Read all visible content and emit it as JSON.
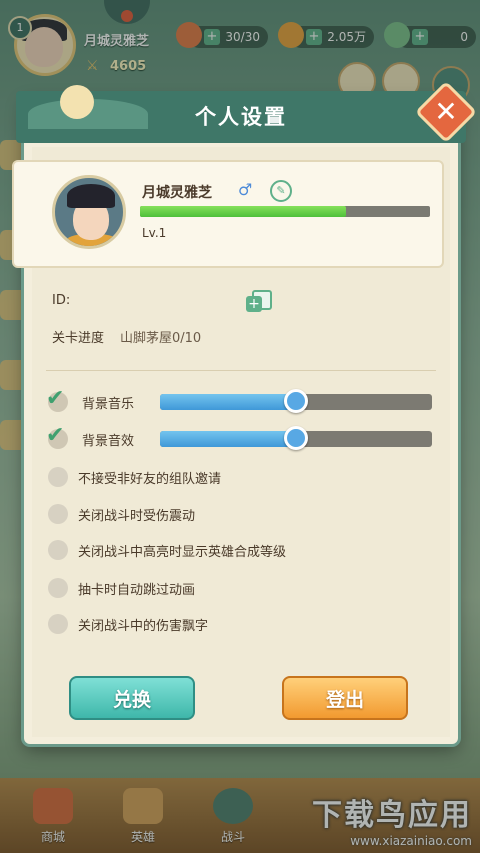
{
  "hud": {
    "level": "1",
    "player_name": "月城灵雅芝",
    "power": "4605",
    "stamina": "30/30",
    "coins": "2.05万",
    "gems": "0"
  },
  "modal": {
    "title": "个人设置",
    "close_label": "✕",
    "profile": {
      "name": "月城灵雅芝",
      "gender_glyph": "♂",
      "edit_glyph": "✎",
      "level": "Lv.1",
      "exp_fraction": 0.71
    },
    "id_label": "ID:",
    "id_value": "",
    "progress_label": "关卡进度",
    "progress_value": "山脚茅屋0/10",
    "settings": [
      {
        "label": "背景音乐",
        "checked": true,
        "slider": 0.5
      },
      {
        "label": "背景音效",
        "checked": true,
        "slider": 0.5
      },
      {
        "label": "不接受非好友的组队邀请",
        "checked": false
      },
      {
        "label": "关闭战斗时受伤震动",
        "checked": false
      },
      {
        "label": "关闭战斗中高亮时显示英雄合成等级",
        "checked": false
      },
      {
        "label": "抽卡时自动跳过动画",
        "checked": false
      },
      {
        "label": "关闭战斗中的伤害飘字",
        "checked": false
      }
    ],
    "redeem_label": "兑换",
    "logout_label": "登出"
  },
  "bottom_nav": [
    {
      "label": "商城"
    },
    {
      "label": "英雄"
    },
    {
      "label": "战斗"
    }
  ],
  "watermark": {
    "title": "下载鸟应用",
    "url": "www.xiazainiao.com"
  },
  "colors": {
    "accent_green": "#3f7768",
    "exp_green": "#4fbf3a",
    "slider_blue": "#3f98d8",
    "redeem_teal": "#3fb7aa",
    "logout_orange": "#f29a30",
    "close_red": "#e4673f"
  }
}
